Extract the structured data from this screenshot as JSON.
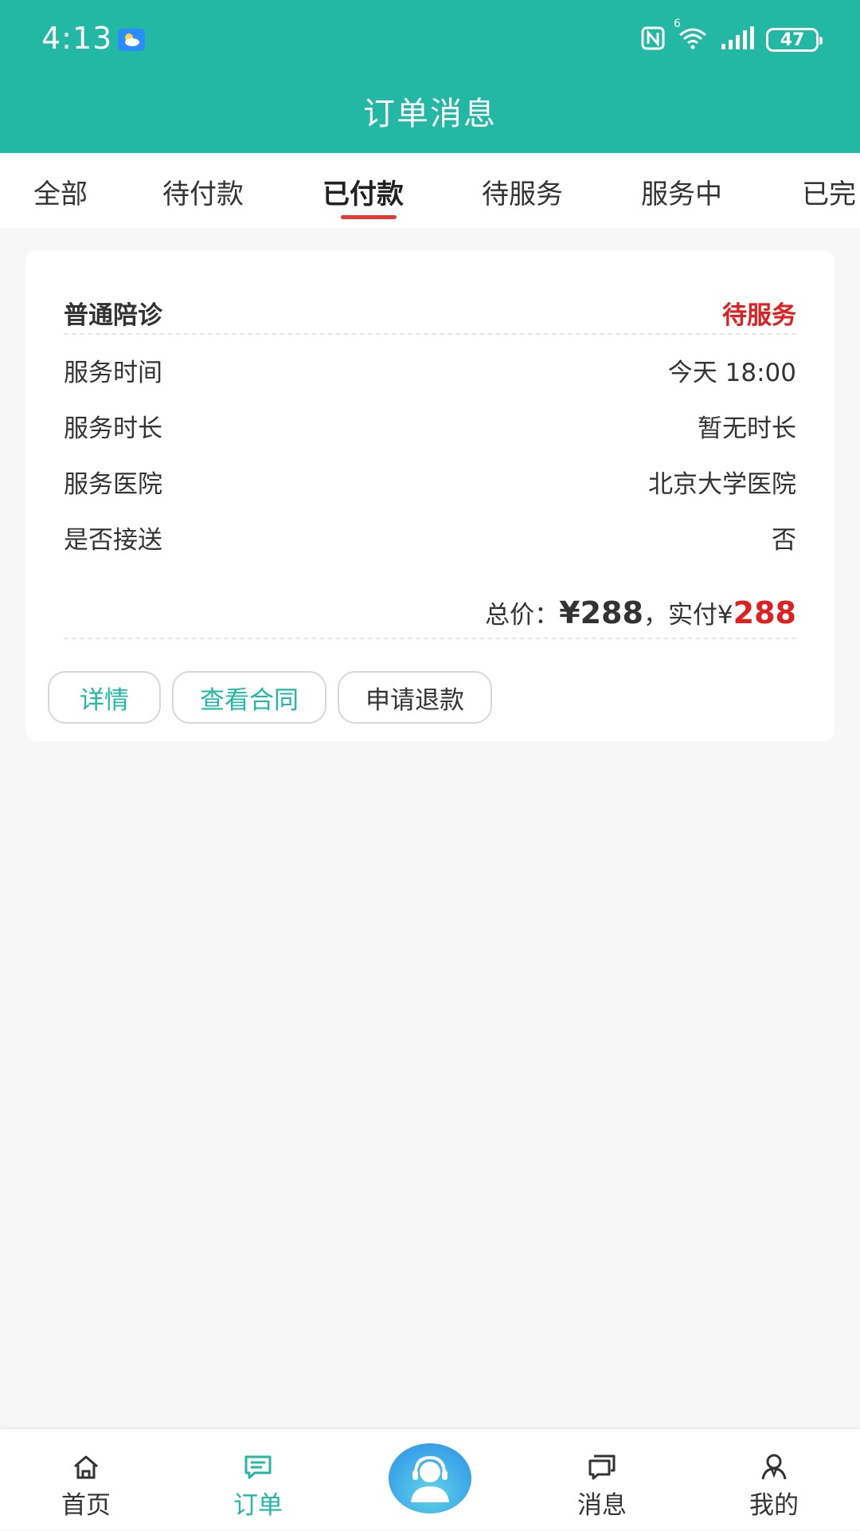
{
  "status_bar": {
    "time": "4:13",
    "network_label": "6",
    "battery": "47"
  },
  "header": {
    "title": "订单消息"
  },
  "tabs": [
    {
      "label": "全部"
    },
    {
      "label": "待付款"
    },
    {
      "label": "已付款",
      "active": true
    },
    {
      "label": "待服务"
    },
    {
      "label": "服务中"
    },
    {
      "label": "已完"
    }
  ],
  "order": {
    "service_name": "普通陪诊",
    "status": "待服务",
    "rows": [
      {
        "label": "服务时间",
        "value": "今天 18:00"
      },
      {
        "label": "服务时长",
        "value": "暂无时长"
      },
      {
        "label": "服务医院",
        "value": "北京大学医院"
      },
      {
        "label": "是否接送",
        "value": "否"
      }
    ],
    "price": {
      "total_label": "总价：",
      "total_value": "¥288",
      "separator": "，",
      "paid_label": "实付¥",
      "paid_value": "288"
    },
    "buttons": {
      "detail": "详情",
      "contract": "查看合同",
      "refund": "申请退款"
    }
  },
  "bottom_nav": {
    "home": "首页",
    "orders": "订单",
    "messages": "消息",
    "mine": "我的"
  },
  "colors": {
    "brand": "#22b8a3",
    "alert": "#e02020",
    "tab_indicator": "#e53935"
  }
}
